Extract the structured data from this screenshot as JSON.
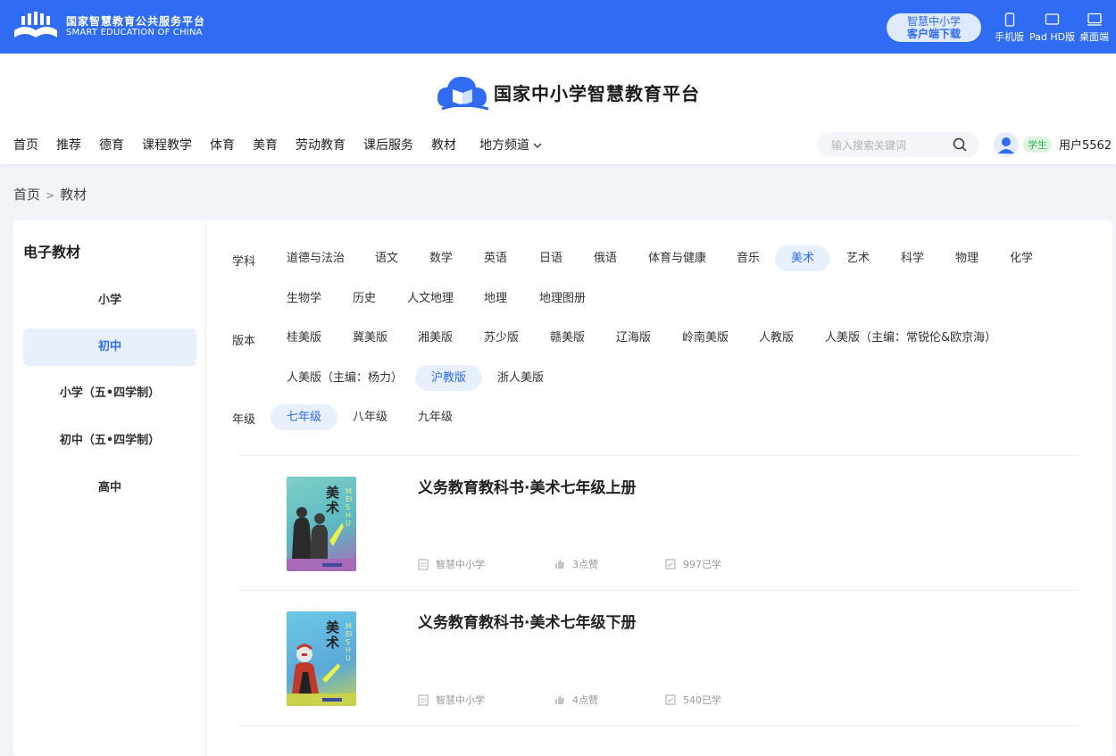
{
  "topbar": {
    "logo_cn": "国家智慧教育公共服务平台",
    "logo_en": "SMART EDUCATION OF CHINA",
    "download_line1": "智慧中小学",
    "download_line2": "客户端下载",
    "devices": [
      "手机版",
      "Pad HD版",
      "桌面端"
    ]
  },
  "header": {
    "brand_title": "国家中小学智慧教育平台",
    "nav": [
      "首页",
      "推荐",
      "德育",
      "课程教学",
      "体育",
      "美育",
      "劳动教育",
      "课后服务",
      "教材",
      "地方频道"
    ],
    "search_placeholder": "输入搜索关键词",
    "role_badge": "学生",
    "username": "用户5562"
  },
  "breadcrumb": {
    "home": "首页",
    "sep": ">",
    "current": "教材"
  },
  "sidebar": {
    "title": "电子教材",
    "items": [
      {
        "label": "小学",
        "active": false
      },
      {
        "label": "初中",
        "active": true
      },
      {
        "label": "小学（五•四学制）",
        "active": false
      },
      {
        "label": "初中（五•四学制）",
        "active": false
      },
      {
        "label": "高中",
        "active": false
      }
    ]
  },
  "filters": {
    "subject_label": "学科",
    "subjects": [
      "道德与法治",
      "语文",
      "数学",
      "英语",
      "日语",
      "俄语",
      "体育与健康",
      "音乐",
      "美术",
      "艺术",
      "科学",
      "物理",
      "化学",
      "生物学",
      "历史",
      "人文地理",
      "地理",
      "地理图册"
    ],
    "subject_active": "美术",
    "edition_label": "版本",
    "editions": [
      "桂美版",
      "冀美版",
      "湘美版",
      "苏少版",
      "赣美版",
      "辽海版",
      "岭南美版",
      "人教版",
      "人美版（主编：常锐伦&欧京海）",
      "人美版（主编：杨力）",
      "沪教版",
      "浙人美版"
    ],
    "edition_active": "沪教版",
    "grade_label": "年级",
    "grades": [
      "七年级",
      "八年级",
      "九年级"
    ],
    "grade_active": "七年级"
  },
  "books": [
    {
      "title": "义务教育教科书·美术七年级上册",
      "publisher": "智慧中小学",
      "likes": "3点赞",
      "learners": "997已学",
      "cover_cn": "美术",
      "cover_pinyin": "MEI SHU",
      "cover_color": "#7fd0c6"
    },
    {
      "title": "义务教育教科书·美术七年级下册",
      "publisher": "智慧中小学",
      "likes": "4点赞",
      "learners": "540已学",
      "cover_cn": "美术",
      "cover_pinyin": "MEI SHU",
      "cover_color": "#5fb4de"
    }
  ],
  "colors": {
    "primary": "#2f6cf3",
    "active_bg": "#e8f0fe",
    "page_bg": "#f1f4f9"
  }
}
